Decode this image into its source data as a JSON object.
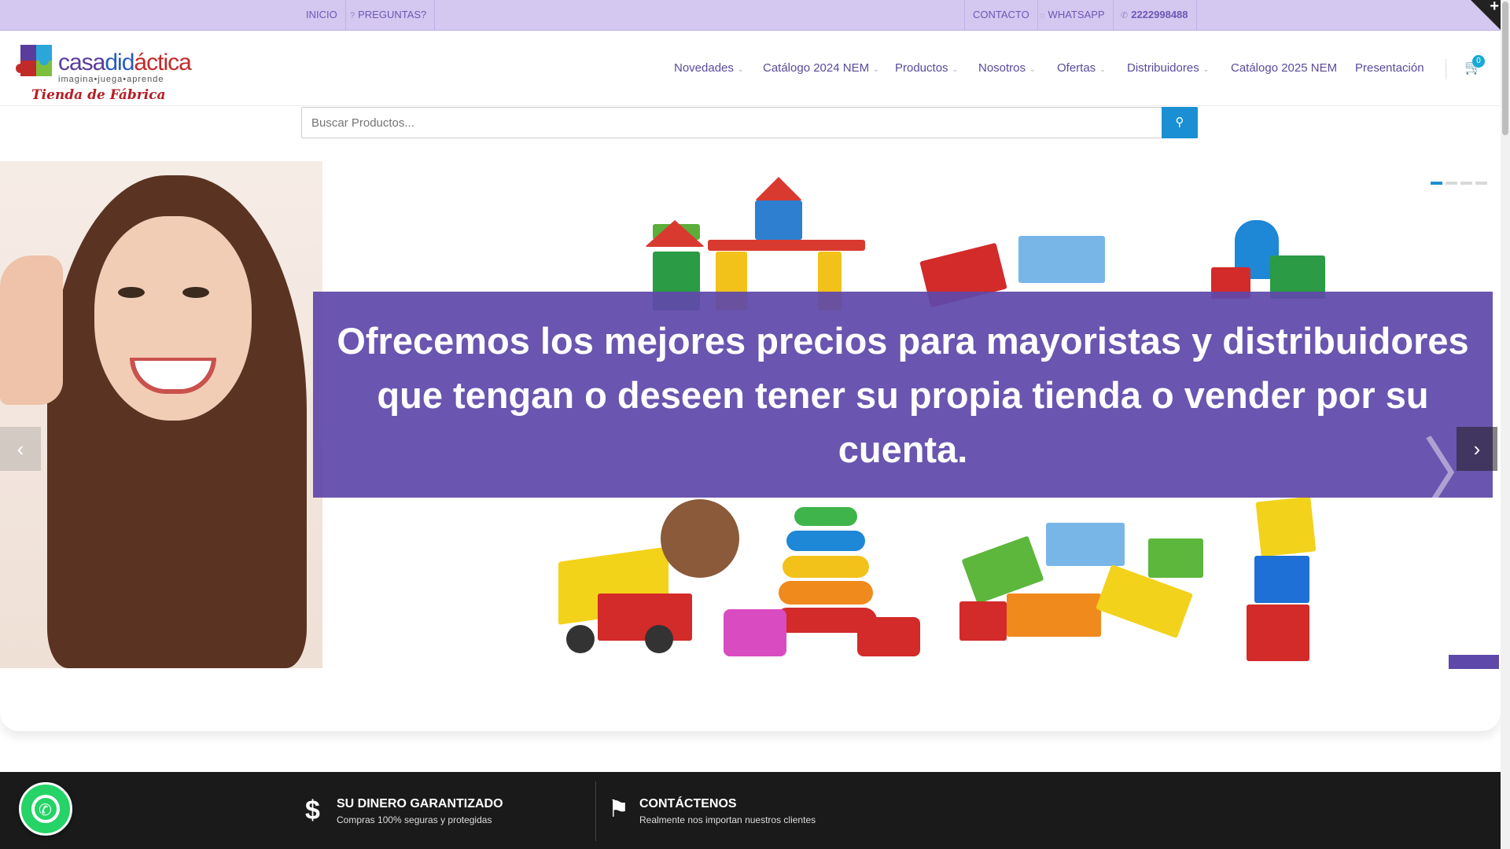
{
  "topbar": {
    "inicio": "INICIO",
    "preguntas_icon": "question-icon",
    "preguntas": "PREGUNTAS?",
    "contacto": "CONTACTO",
    "whatsapp_icon": "whatsapp-icon",
    "whatsapp": "WHATSAPP",
    "phone_icon": "phone-icon",
    "phone": "2222998488"
  },
  "logo": {
    "brand_a": "casa",
    "brand_b": "did",
    "brand_c": "áctica",
    "slogan": "imagina•juega•aprende",
    "tagline": "Tienda de Fábrica"
  },
  "nav": {
    "items": [
      {
        "label": "Novedades",
        "dropdown": true
      },
      {
        "label": "Catálogo 2024 NEM",
        "dropdown": true
      },
      {
        "label": "Productos",
        "dropdown": true
      },
      {
        "label": "Nosotros",
        "dropdown": true
      },
      {
        "label": "Ofertas",
        "dropdown": true
      },
      {
        "label": "Distribuidores",
        "dropdown": true
      },
      {
        "label": "Catálogo 2025 NEM",
        "dropdown": false
      },
      {
        "label": "Presentación",
        "dropdown": false
      }
    ],
    "cart_count": "0"
  },
  "search": {
    "placeholder": "Buscar Productos..."
  },
  "hero": {
    "banner_text": "Ofrecemos los mejores precios para mayoristas y distribuidores que tengan o deseen tener su propia tienda o vender por su cuenta.",
    "active_slide": 1,
    "slide_count": 4,
    "prev_glyph": "‹",
    "next_glyph": "›"
  },
  "features": [
    {
      "icon": "$",
      "title": "SU DINERO GARANTIZADO",
      "subtitle": "Compras 100% seguras y protegidas"
    },
    {
      "icon": "⚑",
      "title": "CONTÁCTENOS",
      "subtitle": "Realmente nos importan nuestros clientes"
    }
  ],
  "colors": {
    "topbar_bg": "#d4c7f0",
    "accent_purple": "#5e48aa",
    "accent_blue": "#1a8fd3",
    "footer_bg": "#1a1a1a",
    "whatsapp_green": "#25d366"
  }
}
